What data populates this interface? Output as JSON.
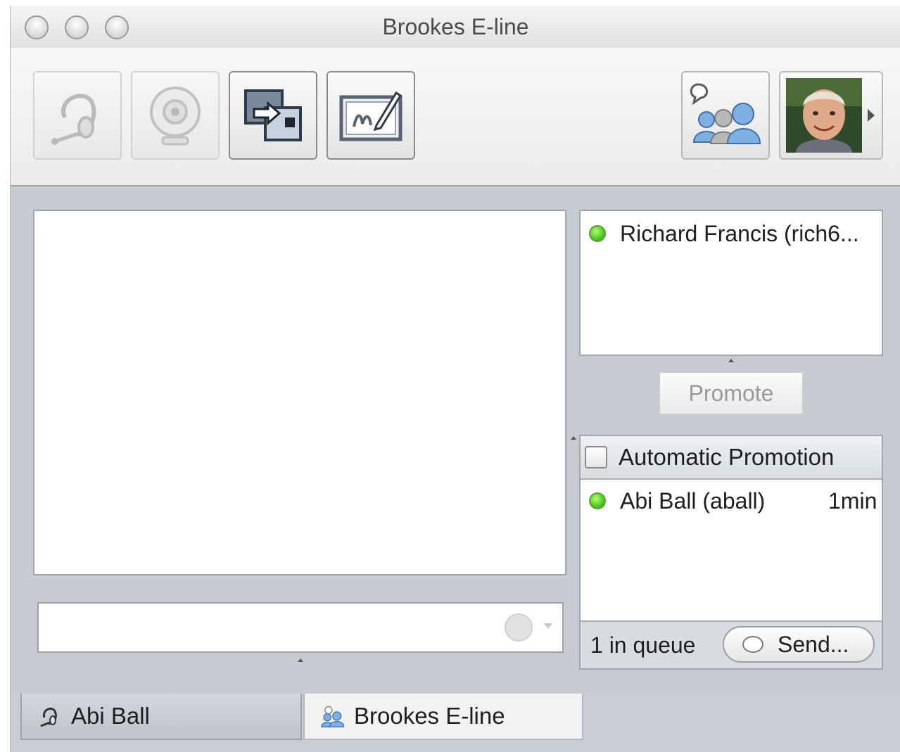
{
  "window": {
    "title": "Brookes E-line"
  },
  "toolbar": {
    "buttons": [
      {
        "icon": "headset-icon",
        "enabled": false
      },
      {
        "icon": "webcam-icon",
        "enabled": false
      },
      {
        "icon": "screen-share-icon",
        "enabled": true
      },
      {
        "icon": "whiteboard-icon",
        "enabled": true
      },
      {
        "icon": "group-chat-icon",
        "enabled": true
      },
      {
        "icon": "user-avatar",
        "enabled": true
      }
    ]
  },
  "participants": {
    "items": [
      {
        "name": "Richard Francis (rich6...",
        "status": "online"
      }
    ]
  },
  "promote_label": "Promote",
  "queue": {
    "automatic_promotion_label": "Automatic Promotion",
    "automatic_promotion_checked": false,
    "items": [
      {
        "name": "Abi Ball (aball)",
        "wait": "1min",
        "status": "online"
      }
    ],
    "count_label": "1 in queue",
    "send_label": "Send..."
  },
  "tabs": [
    {
      "label": "Abi Ball",
      "active": false
    },
    {
      "label": "Brookes E-line",
      "active": true
    }
  ],
  "colors": {
    "online": "#3fbf1c",
    "window_bg": "#c8ccd2"
  }
}
